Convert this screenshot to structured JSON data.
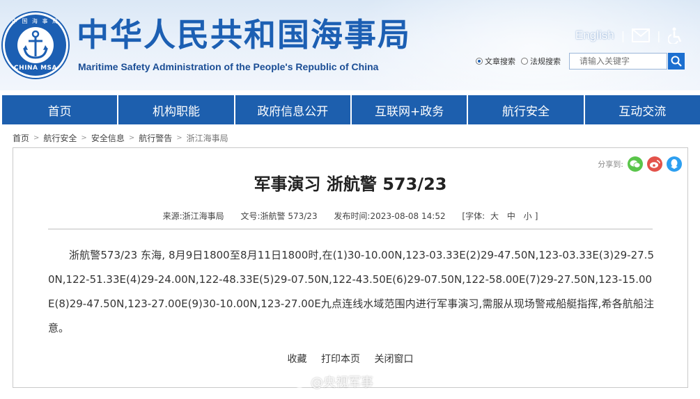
{
  "header": {
    "title": "中华人民共和国海事局",
    "subtitle": "Maritime Safety Administration of the People's Republic of China",
    "logo_cn": "中 国 海 事 局",
    "logo_en": "CHINA MSA",
    "english_link": "English",
    "separator": "|",
    "search": {
      "option1": "文章搜索",
      "option2": "法规搜索",
      "placeholder": "请输入关键字"
    }
  },
  "nav": {
    "items": [
      "首页",
      "机构职能",
      "政府信息公开",
      "互联网+政务",
      "航行安全",
      "互动交流"
    ]
  },
  "breadcrumb": {
    "items": [
      "首页",
      "航行安全",
      "安全信息",
      "航行警告",
      "浙江海事局"
    ]
  },
  "article": {
    "share_label": "分享到:",
    "title": "军事演习 浙航警 573/23",
    "meta": {
      "source": "来源:浙江海事局",
      "doc_no": "文号:浙航警 573/23",
      "published": "发布时间:2023-08-08 14:52",
      "font_label": "[字体:",
      "font_large": "大",
      "font_medium": "中",
      "font_small": "小",
      "font_close": "]"
    },
    "body": "浙航警573/23 东海, 8月9日1800至8月11日1800时,在(1)30-10.00N,123-03.33E(2)29-47.50N,123-03.33E(3)29-27.50N,122-51.33E(4)29-24.00N,122-48.33E(5)29-07.50N,122-43.50E(6)29-07.50N,122-58.00E(7)29-27.50N,123-15.00E(8)29-47.50N,123-27.00E(9)30-10.00N,123-27.00E九点连线水域范围内进行军事演习,需服从现场警戒船艇指挥,希各航船注意。",
    "actions": {
      "favorite": "收藏",
      "print": "打印本页",
      "close": "关闭窗口"
    }
  },
  "watermark": "@央视军事",
  "colors": {
    "brand_blue": "#1c5fb3",
    "nav_blue": "#1d5fae",
    "wechat_green": "#5ac54a",
    "weibo_red": "#e3524a",
    "qq_blue": "#2d9ff0"
  }
}
